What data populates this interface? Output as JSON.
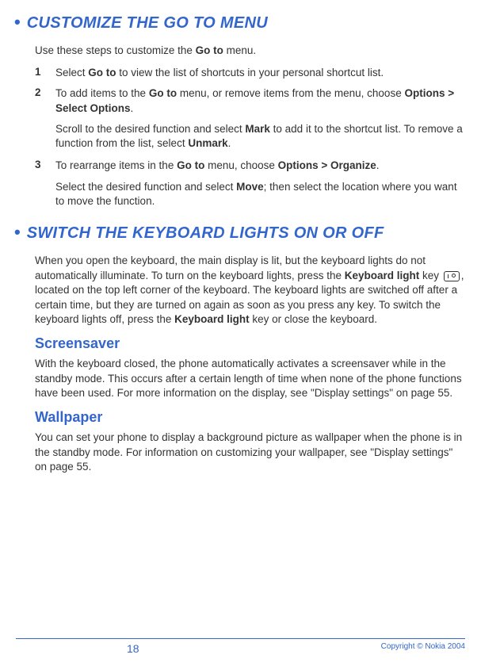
{
  "section1": {
    "title": "CUSTOMIZE THE GO TO MENU",
    "intro_a": "Use these steps to customize the ",
    "intro_b": "Go to",
    "intro_c": " menu.",
    "step1": {
      "num": "1",
      "a": "Select ",
      "b": "Go to",
      "c": " to view the list of shortcuts in your personal shortcut list."
    },
    "step2": {
      "num": "2",
      "a": "To add items to the ",
      "b": "Go to",
      "c": " menu, or remove items from the menu, choose ",
      "d": "Options > Select Options",
      "e": ".",
      "sub_a": "Scroll to the desired function and select ",
      "sub_b": "Mark",
      "sub_c": " to add it to the shortcut list. To remove a function from the list, select ",
      "sub_d": "Unmark",
      "sub_e": "."
    },
    "step3": {
      "num": "3",
      "a": "To rearrange items in the ",
      "b": "Go to",
      "c": " menu, choose ",
      "d": "Options > Organize",
      "e": ".",
      "sub_a": "Select the desired function and select ",
      "sub_b": "Move",
      "sub_c": "; then select the location where you want to move the function."
    }
  },
  "section2": {
    "title": "SWITCH THE KEYBOARD LIGHTS ON OR OFF",
    "p1_a": "When you open the keyboard, the main display is lit, but the keyboard lights do not automatically illuminate. To turn on the keyboard lights, press the ",
    "p1_b": "Keyboard light",
    "p1_c": " key ",
    "p1_d": ", located on the top left corner of the keyboard. The keyboard lights are switched off after a certain time, but they are turned on again as soon as you press any key. To switch the keyboard lights off, press the ",
    "p1_e": "Keyboard light",
    "p1_f": " key or close the keyboard.",
    "sub1": {
      "title": "Screensaver",
      "text": "With the keyboard closed, the phone automatically activates a screensaver while in the standby mode. This occurs after a certain length of time when none of the phone functions have been used. For more information on the display, see \"Display settings\" on page 55."
    },
    "sub2": {
      "title": "Wallpaper",
      "text": "You can set your phone to display a background picture as wallpaper when the phone is in the standby mode. For information on customizing your wallpaper, see \"Display settings\" on page 55."
    }
  },
  "footer": {
    "page": "18",
    "copyright": "Copyright © Nokia 2004"
  }
}
